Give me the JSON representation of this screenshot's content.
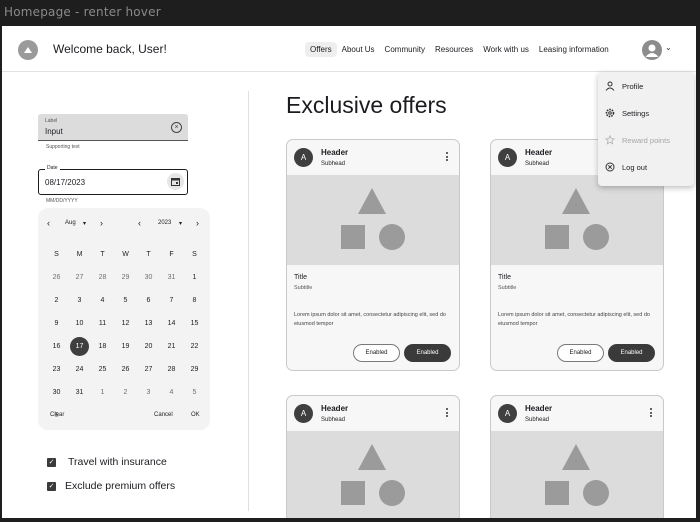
{
  "frame_title": "Homepage - renter hover",
  "header": {
    "welcome": "Welcome back, User!",
    "nav": [
      "Offers",
      "About Us",
      "Community",
      "Resources",
      "Work with us",
      "Leasing information"
    ],
    "active_nav": "Offers"
  },
  "account_menu": {
    "items": [
      {
        "label": "Profile",
        "icon": "person-icon",
        "disabled": false
      },
      {
        "label": "Settings",
        "icon": "gear-icon",
        "disabled": false
      },
      {
        "label": "Reward points",
        "icon": "star-icon",
        "disabled": true
      },
      {
        "label": "Log out",
        "icon": "close-circle-icon",
        "disabled": false
      }
    ]
  },
  "filters": {
    "input": {
      "label": "Label",
      "value": "Input",
      "supporting": "Supporting text"
    },
    "date": {
      "label": "Date",
      "value": "08/17/2023",
      "hint": "MM/DD/YYYY"
    },
    "picker": {
      "month": "Aug",
      "year": "2023",
      "weekdays": [
        "S",
        "M",
        "T",
        "W",
        "T",
        "F",
        "S"
      ],
      "selected": "17",
      "clear": "Clear",
      "cancel": "Cancel",
      "ok": "OK"
    },
    "checkboxes": [
      {
        "label": "Travel with insurance",
        "checked": true
      },
      {
        "label": "Exclude premium offers",
        "checked": true
      }
    ]
  },
  "offers": {
    "heading": "Exclusive offers",
    "cards": [
      {
        "avatar": "A",
        "header": "Header",
        "subhead": "Subhead",
        "title": "Title",
        "subtitle": "Subtitle",
        "body": "Lorem ipsum dolor sit amet, consectetur adipiscing elit, sed do eiusmod tempor",
        "btn_outline": "Enabled",
        "btn_filled": "Enabled"
      },
      {
        "avatar": "A",
        "header": "Header",
        "subhead": "Subhead",
        "title": "Title",
        "subtitle": "Subtitle",
        "body": "Lorem ipsum dolor sit amet, consectetur adipiscing elit, sed do eiusmod tempor",
        "btn_outline": "Enabled",
        "btn_filled": "Enabled"
      },
      {
        "avatar": "A",
        "header": "Header",
        "subhead": "Subhead"
      },
      {
        "avatar": "A",
        "header": "Header",
        "subhead": "Subhead"
      }
    ]
  }
}
